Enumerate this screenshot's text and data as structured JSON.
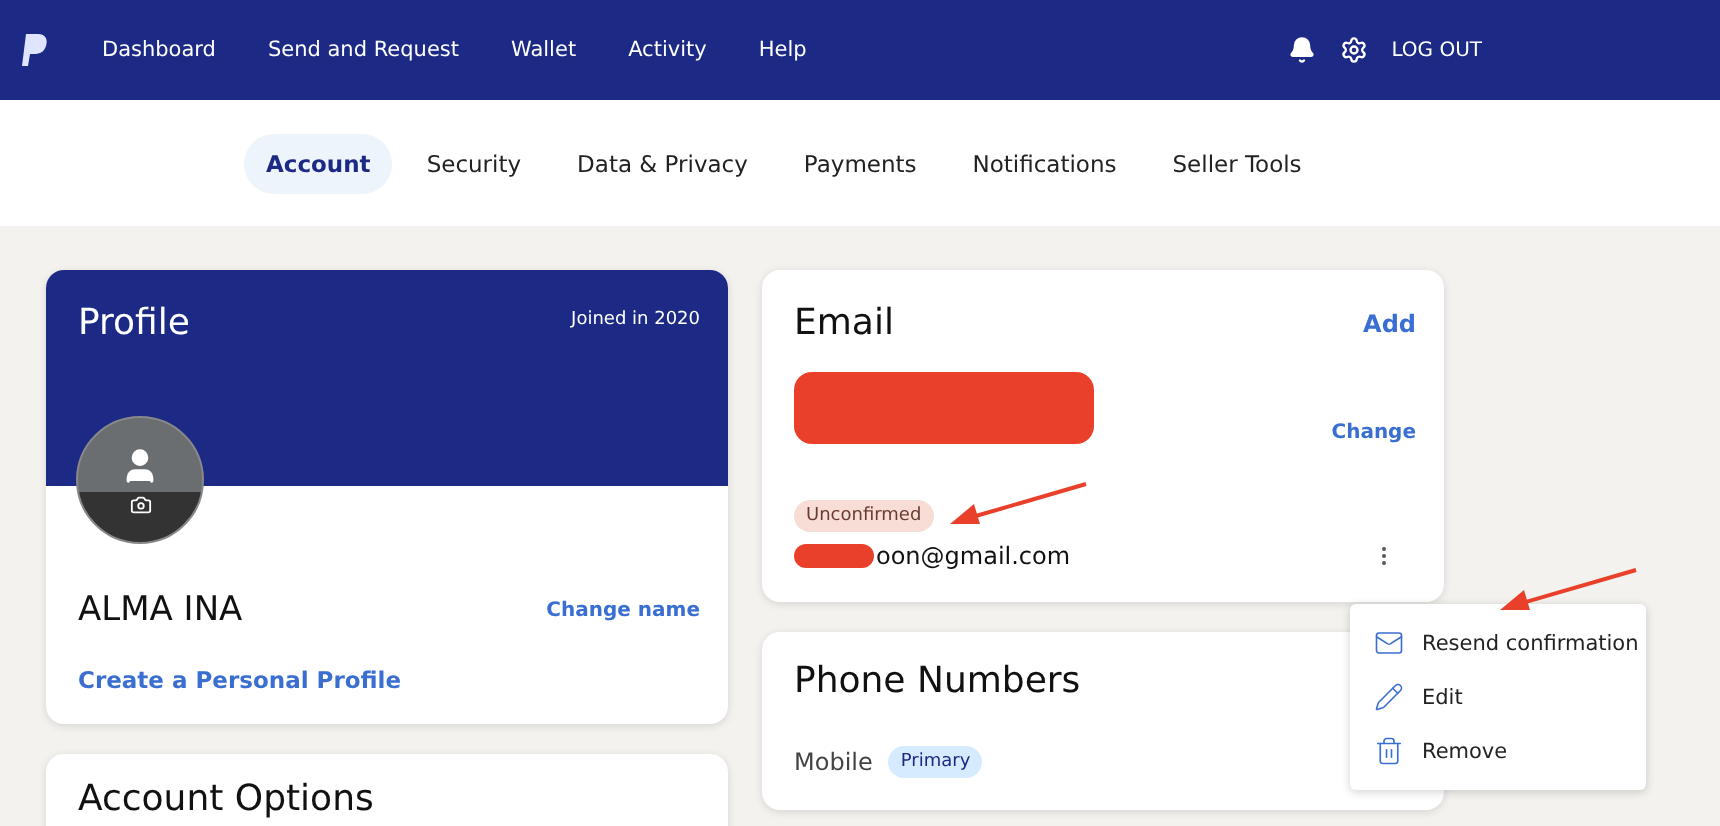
{
  "nav": {
    "items": [
      "Dashboard",
      "Send and Request",
      "Wallet",
      "Activity",
      "Help"
    ],
    "logout": "LOG OUT"
  },
  "tabs": [
    {
      "label": "Account",
      "selected": true
    },
    {
      "label": "Security",
      "selected": false
    },
    {
      "label": "Data & Privacy",
      "selected": false
    },
    {
      "label": "Payments",
      "selected": false
    },
    {
      "label": "Notifications",
      "selected": false
    },
    {
      "label": "Seller Tools",
      "selected": false
    }
  ],
  "profile": {
    "title": "Profile",
    "joined": "Joined in 2020",
    "name": "ALMA INA",
    "change_name": "Change name",
    "create_link": "Create a Personal Profile"
  },
  "account_options": {
    "title": "Account Options"
  },
  "email": {
    "title": "Email",
    "add": "Add",
    "change": "Change",
    "badge": "Unconfirmed",
    "address": "oon@gmail.com"
  },
  "menu": [
    {
      "kind": "mail",
      "label": "Resend confirmation"
    },
    {
      "kind": "edit",
      "label": "Edit"
    },
    {
      "kind": "trash",
      "label": "Remove"
    }
  ],
  "phone": {
    "title": "Phone Numbers",
    "type": "Mobile",
    "badge": "Primary"
  }
}
